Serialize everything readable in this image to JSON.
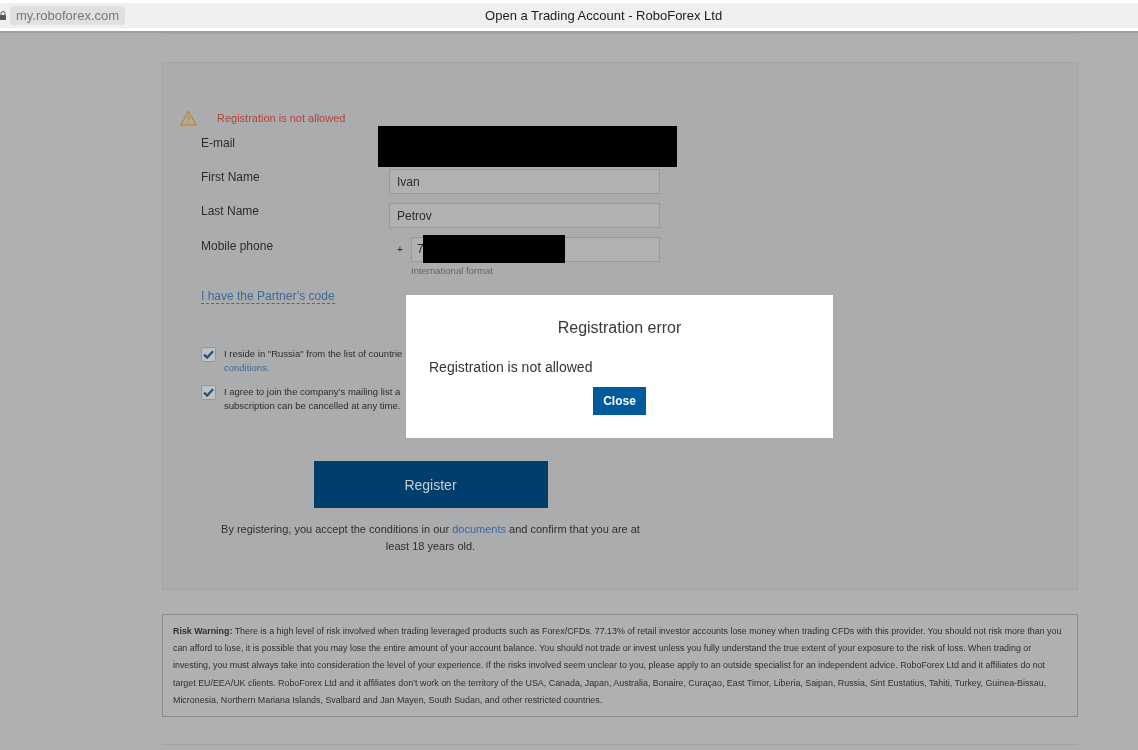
{
  "browser": {
    "address": "my.roboforex.com",
    "title": "Open a Trading Account - RoboForex Ltd"
  },
  "form": {
    "error": "Registration is not allowed",
    "fields": [
      {
        "kind": "redacted",
        "label": "E-mail"
      },
      {
        "kind": "text",
        "label": "First Name",
        "value": "Ivan"
      },
      {
        "kind": "text",
        "label": "Last Name",
        "value": "Petrov"
      },
      {
        "kind": "phone",
        "label": "Mobile phone",
        "prefix": "+",
        "value": "7",
        "redacted": true,
        "hint": "International format"
      }
    ],
    "partner_link": "I have the Partner’s code",
    "checkboxes": [
      {
        "checked": true,
        "lines": [
          {
            "kind": "text",
            "text": "I reside in \"Russia\" from the list of countrie"
          },
          {
            "kind": "link",
            "text": "conditions."
          }
        ]
      },
      {
        "checked": true,
        "lines": [
          {
            "kind": "text",
            "text": "I agree to join the company’s mailing list a"
          },
          {
            "kind": "text",
            "text": "subscription can be cancelled at any time."
          }
        ]
      }
    ],
    "register_button": "Register",
    "terms": {
      "text": "By registering, you accept the conditions in our",
      "link": "documents",
      "text_after": "and confirm that you are at least 18 years old."
    }
  },
  "risk_warning": "**Risk Warning:** There is a high level of risk involved when trading leveraged products such as Forex/CFDs. 77.13% of retail investor accounts lose money when trading CFDs with this provider. You should not risk more than you can afford to lose, it is possible that you may lose the entire amount of your account balance. You should not trade or invest unless you fully understand the true extent of your exposure to the risk of loss. When trading or investing, you must always take into consideration the level of your experience. If the risks involved seem unclear to you, please apply to an outside specialist for an independent advice. RoboForex Ltd and it affiliates do not target EU/EEA/UK clients. RoboForex Ltd and it affiliates don’t work on the territory of the USA, Canada, Japan, Australia, Bonaire, Curaçao, East Timor, Liberia, Saipan, Russia, Sint Eustatius, Tahiti, Turkey, Guinea-Bissau, Micronesia, Northern Mariana Islands, Svalbard and Jan Mayen, South Sudan, and other restricted countries.",
  "dialog": {
    "title": "Registration error",
    "message": "Registration is not allowed",
    "button": "Close"
  }
}
